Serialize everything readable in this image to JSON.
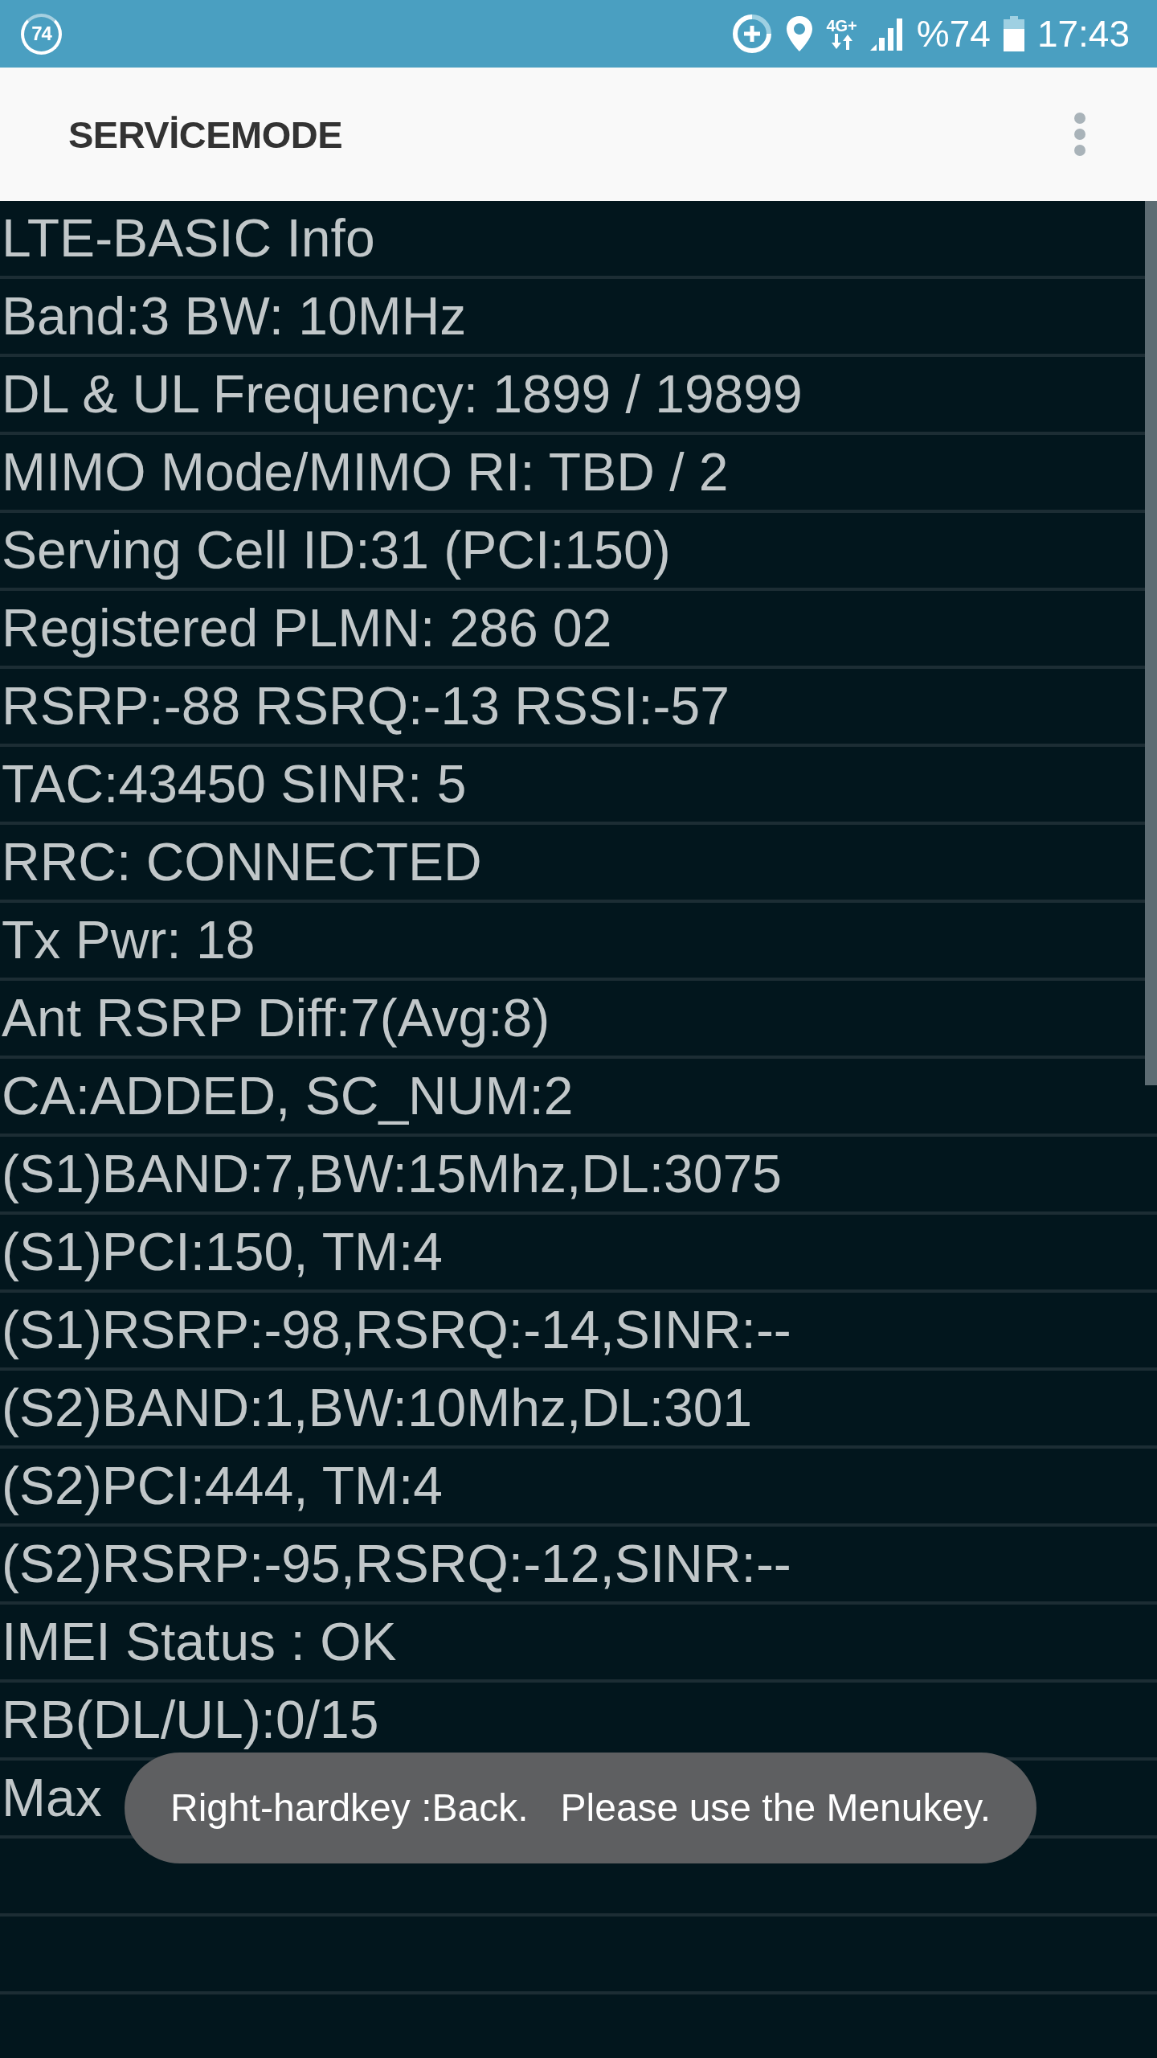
{
  "status_bar": {
    "badge": "74",
    "network": "4G+",
    "battery": "%74",
    "time": "17:43"
  },
  "app_bar": {
    "title": "SERVİCEMODE"
  },
  "info_lines": [
    "LTE-BASIC Info",
    "Band:3 BW: 10MHz",
    "DL & UL Frequency: 1899 / 19899",
    "MIMO Mode/MIMO RI: TBD / 2",
    "Serving Cell ID:31 (PCI:150)",
    "Registered PLMN: 286 02",
    "RSRP:-88 RSRQ:-13 RSSI:-57",
    "TAC:43450 SINR: 5",
    "RRC: CONNECTED",
    "Tx Pwr: 18",
    "Ant RSRP Diff:7(Avg:8)",
    "CA:ADDED, SC_NUM:2",
    "(S1)BAND:7,BW:15Mhz,DL:3075",
    "(S1)PCI:150, TM:4",
    "(S1)RSRP:-98,RSRQ:-14,SINR:--",
    "(S2)BAND:1,BW:10Mhz,DL:301",
    "(S2)PCI:444, TM:4",
    "(S2)RSRP:-95,RSRQ:-12,SINR:--",
    "IMEI Status : OK",
    "RB(DL/UL):0/15",
    "Max"
  ],
  "toast": {
    "text": "Right-hardkey :Back.   Please use the Menukey."
  }
}
